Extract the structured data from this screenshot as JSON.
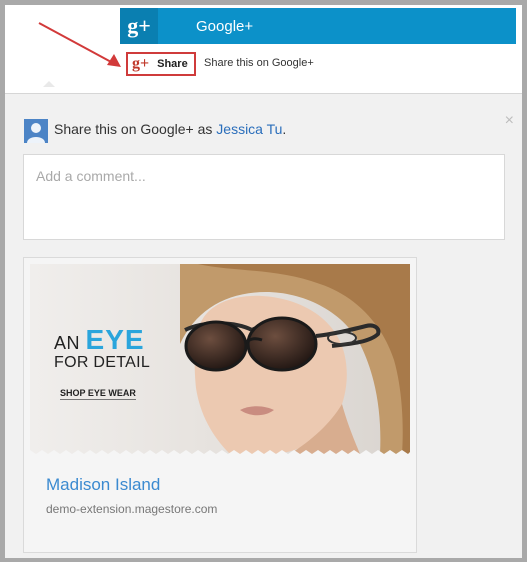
{
  "header": {
    "logo": "g+",
    "title": "Google+"
  },
  "share_button": {
    "logo": "g+",
    "label": "Share",
    "description": "Share this on Google+"
  },
  "panel": {
    "share_prefix": "Share this on Google+ as ",
    "user_name": "Jessica Tu",
    "share_suffix": ".",
    "close_glyph": "×",
    "comment_placeholder": "Add a comment..."
  },
  "card": {
    "ad_line1_prefix": "AN ",
    "ad_line1_emph": "EYE",
    "ad_line2": "FOR DETAIL",
    "ad_cta": "SHOP EYE WEAR",
    "title": "Madison Island",
    "domain": "demo-extension.magestore.com"
  },
  "colors": {
    "google_blue": "#0c91c9",
    "google_red": "#cf3b3b",
    "link_blue": "#2a6ebb",
    "accent_cyan": "#2aa5dc"
  }
}
